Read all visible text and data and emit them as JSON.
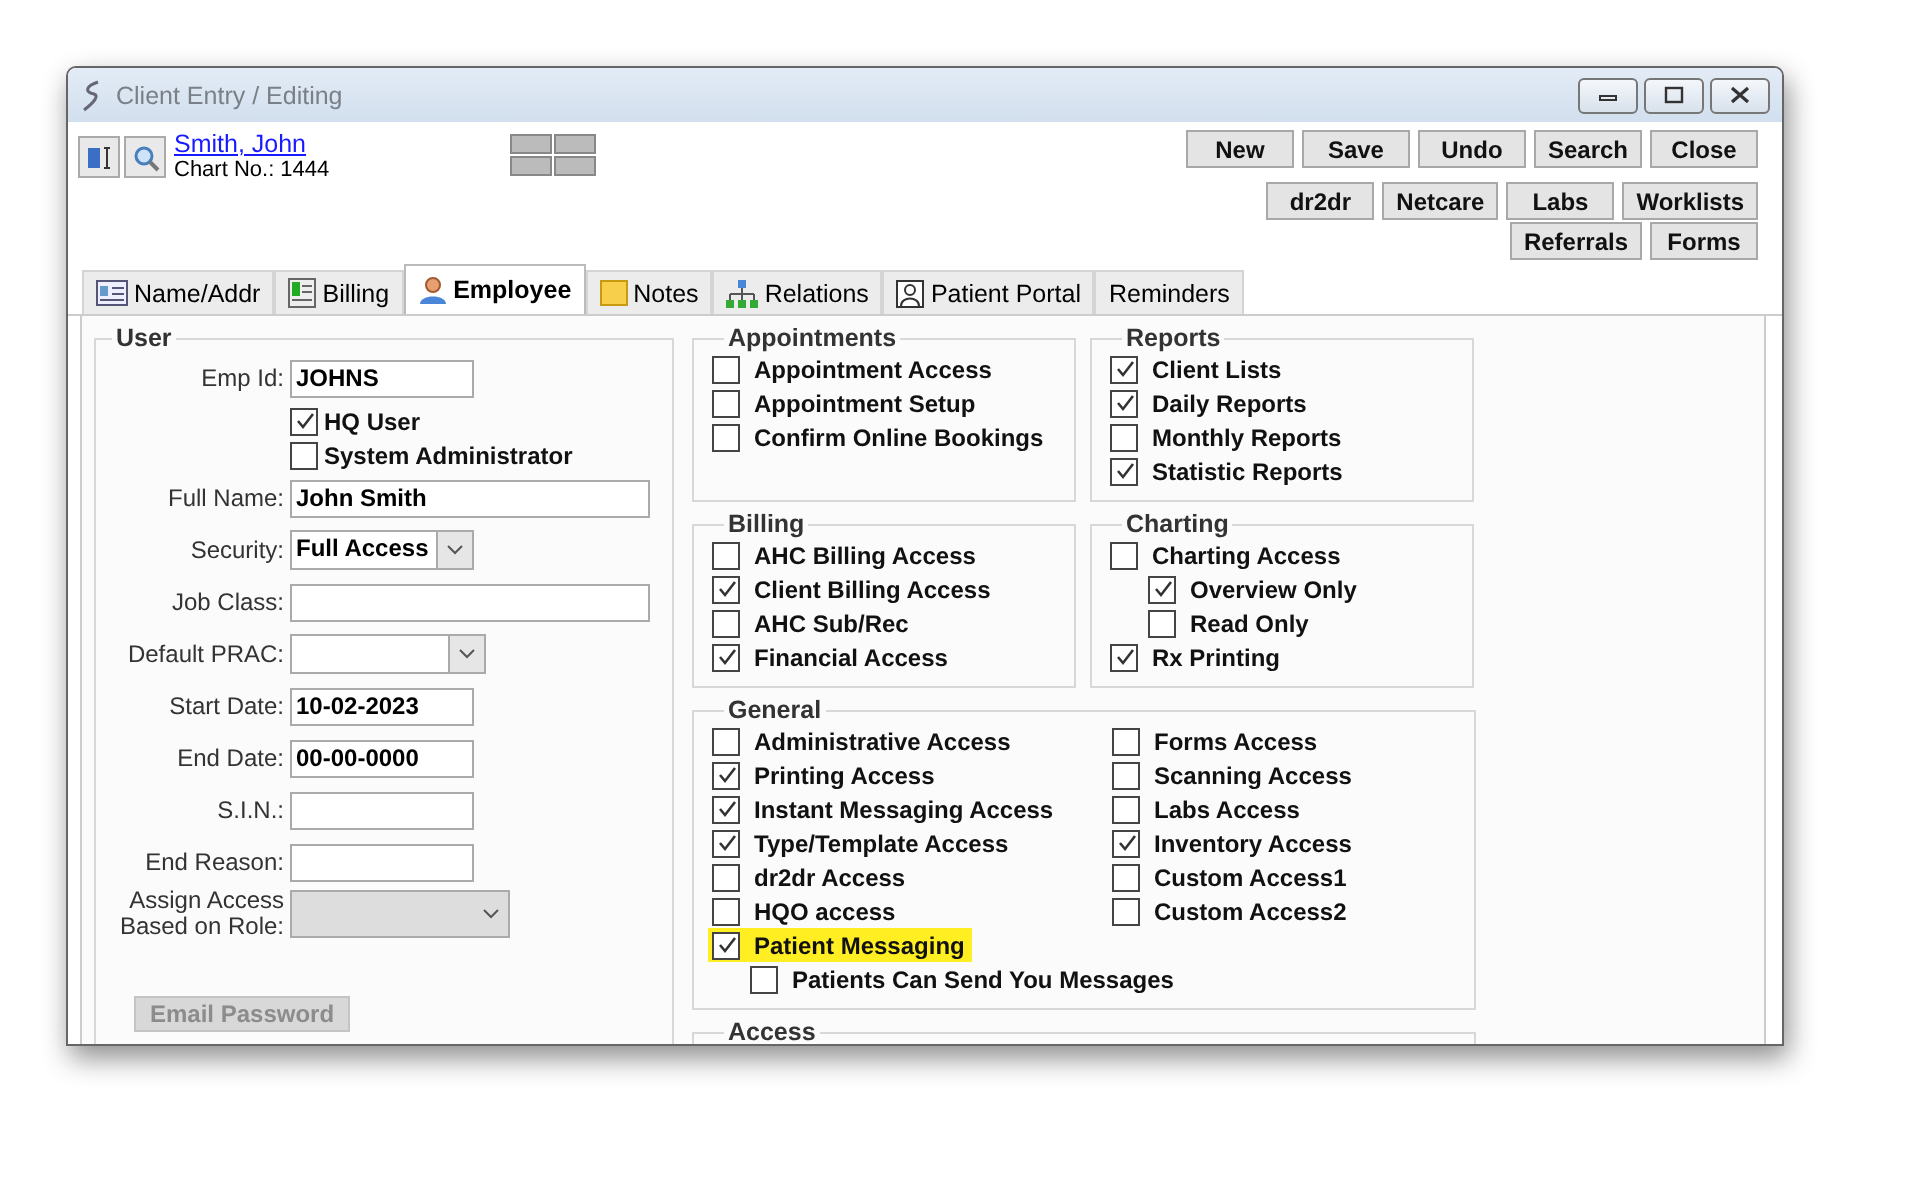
{
  "window": {
    "title": "Client Entry / Editing"
  },
  "patient": {
    "name": "Smith, John",
    "chart_no": "Chart No.: 1444"
  },
  "toolbar_rows": [
    [
      {
        "label": "New"
      },
      {
        "label": "Save"
      },
      {
        "label": "Undo"
      },
      {
        "label": "Search"
      },
      {
        "label": "Close"
      }
    ],
    [
      {
        "label": "dr2dr"
      },
      {
        "label": "Netcare"
      },
      {
        "label": "Labs"
      },
      {
        "label": "Worklists"
      }
    ],
    [
      {
        "label": "Referrals"
      },
      {
        "label": "Forms"
      }
    ]
  ],
  "tabs": [
    {
      "label": "Name/Addr",
      "selected": false
    },
    {
      "label": "Billing",
      "selected": false
    },
    {
      "label": "Employee",
      "selected": true
    },
    {
      "label": "Notes",
      "selected": false
    },
    {
      "label": "Relations",
      "selected": false
    },
    {
      "label": "Patient Portal",
      "selected": false
    },
    {
      "label": "Reminders",
      "selected": false
    }
  ],
  "user": {
    "title": "User",
    "fields": [
      {
        "kind": "text",
        "label": "Emp Id:",
        "value": "JOHNS"
      },
      {
        "kind": "checkbox",
        "label": "HQ User",
        "checked": true
      },
      {
        "kind": "checkbox",
        "label": "System Administrator",
        "checked": false
      },
      {
        "kind": "text",
        "label": "Full Name:",
        "value": "John Smith"
      },
      {
        "kind": "select",
        "label": "Security:",
        "value": "Full Access",
        "disabled": false
      },
      {
        "kind": "text",
        "label": "Job Class:"
      },
      {
        "kind": "select",
        "label": "Default PRAC:",
        "disabled": false
      },
      {
        "kind": "text",
        "label": "Start Date:",
        "value": "10-02-2023"
      },
      {
        "kind": "text",
        "label": "End Date:",
        "value": "00-00-0000"
      },
      {
        "kind": "text",
        "label": "S.I.N.:"
      },
      {
        "kind": "text",
        "label": "End Reason:"
      },
      {
        "kind": "select",
        "label": "Assign Access Based on Role:",
        "disabled": true
      }
    ],
    "email_button": {
      "label": "Email Password",
      "disabled": true
    }
  },
  "groups": [
    {
      "title": "Appointments",
      "kind": "half",
      "columns": [
        [
          {
            "label": "Appointment Access",
            "checked": false
          },
          {
            "label": "Appointment Setup",
            "checked": false
          },
          {
            "label": "Confirm Online Bookings",
            "checked": false
          }
        ]
      ]
    },
    {
      "title": "Reports",
      "kind": "half",
      "columns": [
        [
          {
            "label": "Client Lists",
            "checked": true
          },
          {
            "label": "Daily Reports",
            "checked": true
          },
          {
            "label": "Monthly Reports",
            "checked": false
          },
          {
            "label": "Statistic Reports",
            "checked": true
          }
        ]
      ]
    },
    {
      "title": "Billing",
      "kind": "half",
      "columns": [
        [
          {
            "label": "AHC Billing Access",
            "checked": false
          },
          {
            "label": "Client Billing Access",
            "checked": true
          },
          {
            "label": "AHC Sub/Rec",
            "checked": false
          },
          {
            "label": "Financial Access",
            "checked": true
          }
        ]
      ]
    },
    {
      "title": "Charting",
      "kind": "half",
      "columns": [
        [
          {
            "label": "Charting Access",
            "checked": false,
            "children": [
              {
                "label": "Overview Only",
                "checked": true
              },
              {
                "label": "Read Only",
                "checked": false
              }
            ]
          },
          {
            "label": "Rx Printing",
            "checked": true
          }
        ]
      ]
    },
    {
      "title": "General",
      "kind": "full",
      "columns": [
        [
          {
            "label": "Administrative Access",
            "checked": false
          },
          {
            "label": "Printing Access",
            "checked": true
          },
          {
            "label": "Instant Messaging Access",
            "checked": true
          },
          {
            "label": "Type/Template Access",
            "checked": true
          },
          {
            "label": "dr2dr Access",
            "checked": false
          },
          {
            "label": "HQO access",
            "checked": false
          },
          {
            "label": "Patient Messaging",
            "checked": true,
            "highlighted": true,
            "children": [
              {
                "label": "Patients Can Send You Messages",
                "checked": false
              }
            ]
          }
        ],
        [
          {
            "label": "Forms Access",
            "checked": false
          },
          {
            "label": "Scanning Access",
            "checked": false
          },
          {
            "label": "Labs Access",
            "checked": false
          },
          {
            "label": "Inventory Access",
            "checked": true
          },
          {
            "label": "Custom Access1",
            "checked": false
          },
          {
            "label": "Custom Access2",
            "checked": false
          }
        ]
      ]
    },
    {
      "title": "Access",
      "kind": "full"
    }
  ]
}
